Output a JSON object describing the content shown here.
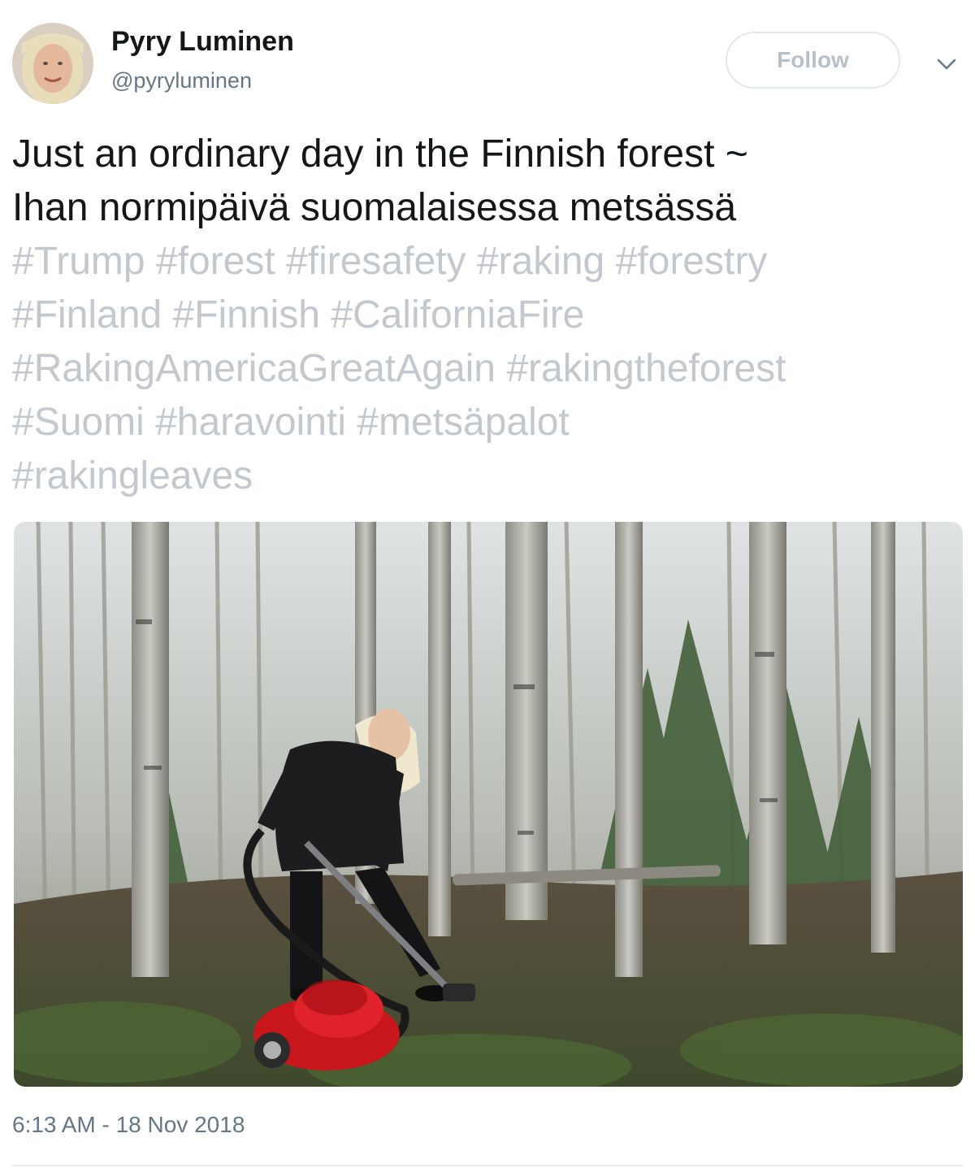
{
  "author": {
    "display_name": "Pyry Luminen",
    "handle": "@pyryluminen"
  },
  "follow_button": {
    "label": "Follow"
  },
  "more_menu": {
    "icon": "chevron-down-icon"
  },
  "tweet": {
    "text_lines": [
      "Just an ordinary day in the Finnish forest ~",
      "Ihan normipäivä suomalaisessa metsässä"
    ],
    "hashtag_rows": [
      [
        "#Trump",
        "#forest",
        "#firesafety",
        "#raking",
        "#forestry"
      ],
      [
        "#Finland",
        "#Finnish",
        "#CaliforniaFire"
      ],
      [
        "#RakingAmericaGreatAgain",
        "#rakingtheforest"
      ],
      [
        "#Suomi",
        "#haravointi",
        "#metsäpalot"
      ],
      [
        "#rakingleaves"
      ]
    ],
    "timestamp": "6:13 AM - 18 Nov 2018"
  },
  "colors": {
    "text": "#14171a",
    "secondary": "#657786",
    "hashtag": "#c2c8cd",
    "border": "#e1e8ed"
  }
}
